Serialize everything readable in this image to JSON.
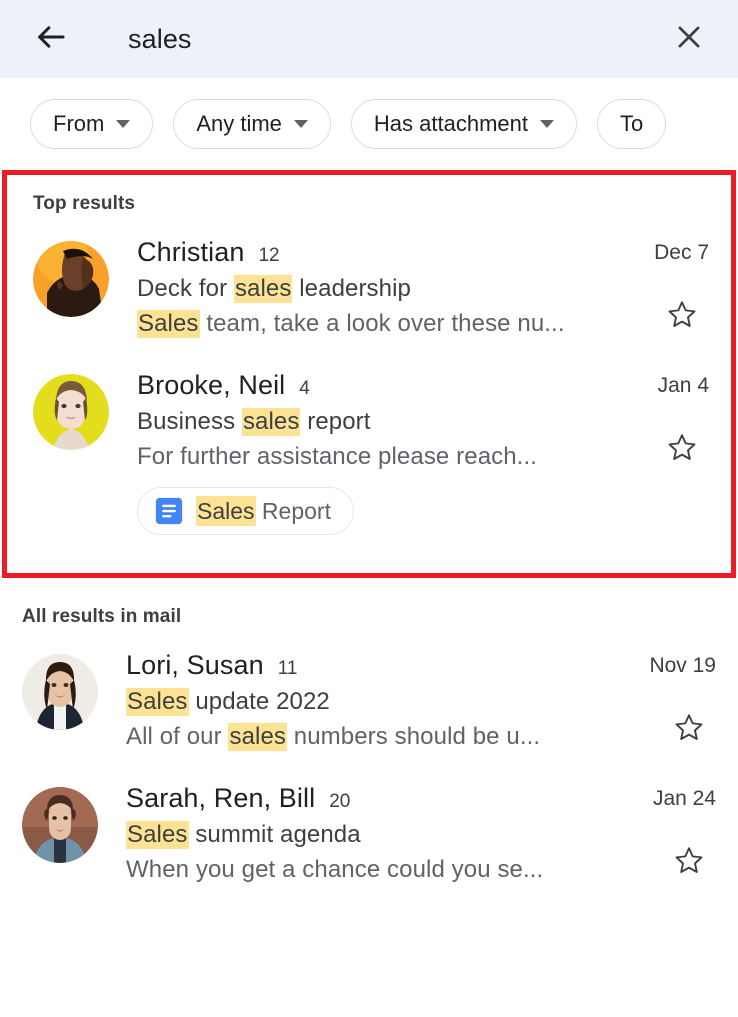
{
  "header": {
    "back_icon": "arrow-back-icon",
    "query": "sales",
    "close_icon": "close-icon"
  },
  "filters": [
    {
      "label": "From",
      "has_caret": true
    },
    {
      "label": "Any time",
      "has_caret": true
    },
    {
      "label": "Has attachment",
      "has_caret": true
    },
    {
      "label": "To",
      "has_caret": false
    }
  ],
  "sections": {
    "top_results_label": "Top results",
    "all_results_label": "All results in mail"
  },
  "colors": {
    "header_bg": "#eef1fa",
    "highlight": "#fde293",
    "annotation_red": "#ed1c24",
    "docs_blue": "#4285f4"
  },
  "top_results": [
    {
      "sender": "Christian",
      "count": "12",
      "subject_pre": "Deck for ",
      "subject_mark": "sales",
      "subject_post": " leadership",
      "snippet_mark": "Sales",
      "snippet_post": " team, take a look over these nu...",
      "snippet_pre": "",
      "date": "Dec 7",
      "star_icon": "star-outline-icon",
      "avatar": "avatar-christian"
    },
    {
      "sender": "Brooke, Neil",
      "count": "4",
      "subject_pre": "Business ",
      "subject_mark": "sales",
      "subject_post": " report",
      "snippet_pre": "For further assistance please reach...",
      "snippet_mark": "",
      "snippet_post": "",
      "date": "Jan 4",
      "star_icon": "star-outline-icon",
      "avatar": "avatar-brooke",
      "attachment": {
        "icon": "google-docs-icon",
        "name_mark": "Sales",
        "name_post": " Report"
      }
    }
  ],
  "all_results": [
    {
      "sender": "Lori, Susan",
      "count": "11",
      "subject_pre": "",
      "subject_mark": "Sales",
      "subject_post": " update 2022",
      "snippet_pre": "All of our ",
      "snippet_mark": "sales",
      "snippet_post": " numbers should be u...",
      "date": "Nov 19",
      "star_icon": "star-outline-icon",
      "avatar": "avatar-lori"
    },
    {
      "sender": "Sarah, Ren, Bill",
      "count": "20",
      "subject_pre": "",
      "subject_mark": "Sales",
      "subject_post": " summit agenda",
      "snippet_pre": "When you get a chance could you se...",
      "snippet_mark": "",
      "snippet_post": "",
      "date": "Jan 24",
      "star_icon": "star-outline-icon",
      "avatar": "avatar-sarah"
    }
  ]
}
